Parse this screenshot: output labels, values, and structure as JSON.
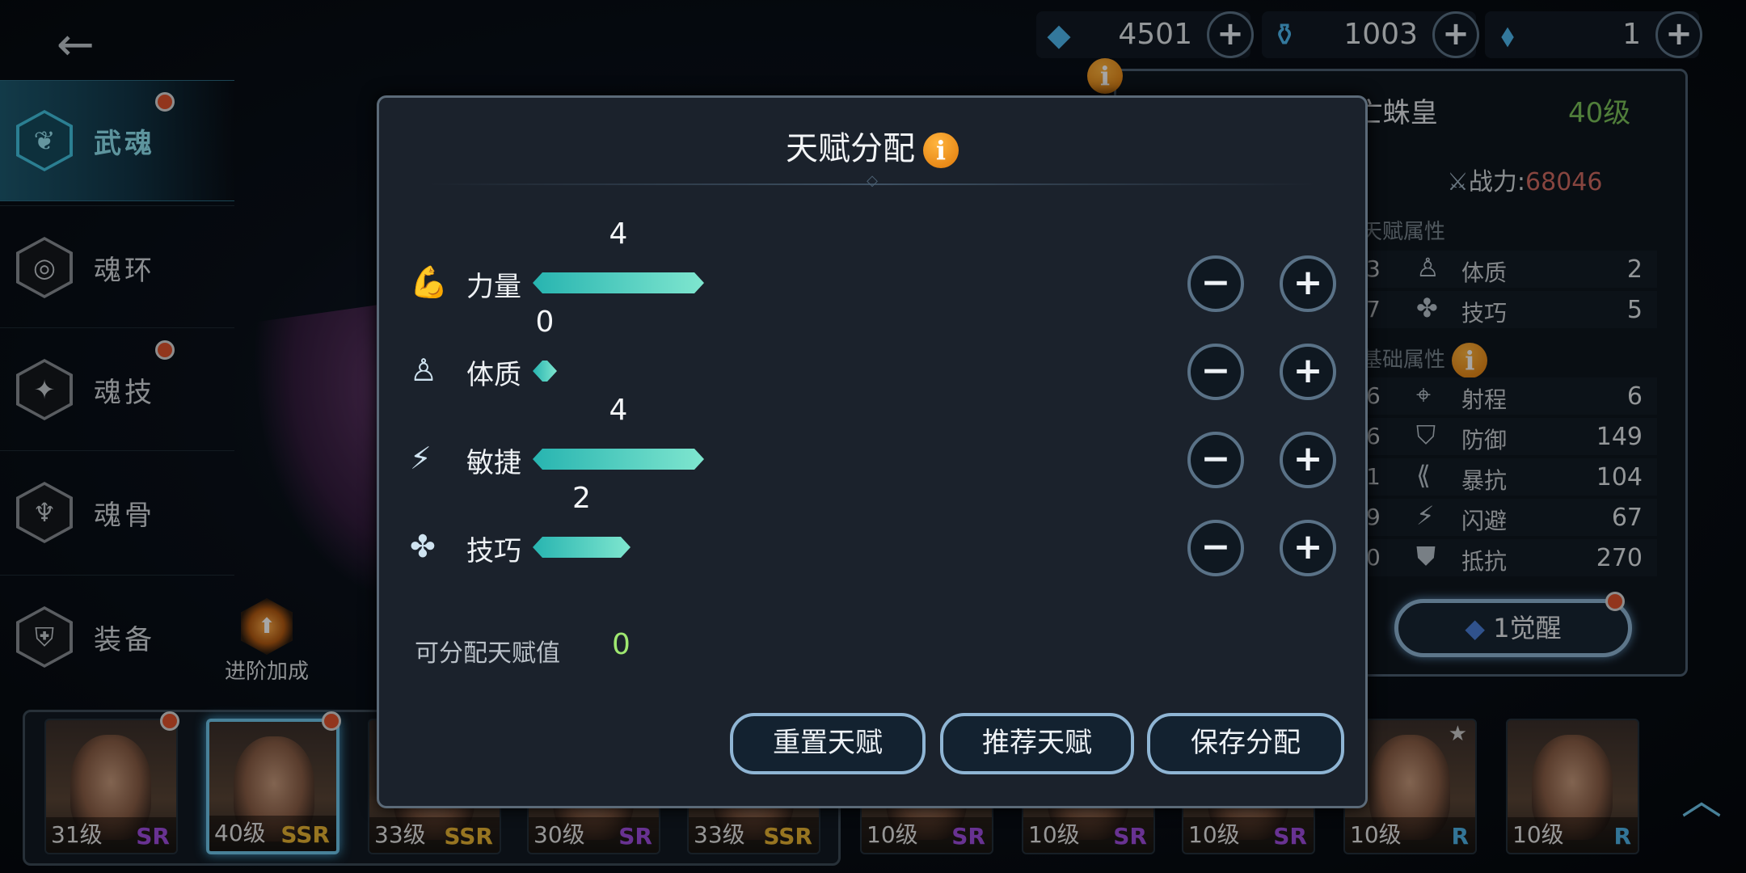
{
  "back_icon": "arrow-left",
  "sidebar": {
    "items": [
      {
        "label": "武魂",
        "icon": "sprout-hex",
        "active": true,
        "badge": true
      },
      {
        "label": "魂环",
        "icon": "ring-hex",
        "active": false,
        "badge": false
      },
      {
        "label": "魂技",
        "icon": "compass-hex",
        "active": false,
        "badge": true
      },
      {
        "label": "魂骨",
        "icon": "bone-hex",
        "active": false,
        "badge": false
      },
      {
        "label": "装备",
        "icon": "armor-hex",
        "active": false,
        "badge": false
      }
    ],
    "advance_label": "进阶加成"
  },
  "currency": [
    {
      "icon": "diamond",
      "value": "4501"
    },
    {
      "icon": "potion-vial",
      "value": "1003"
    },
    {
      "icon": "blue-crystal",
      "value": "1"
    }
  ],
  "hero_panel": {
    "name": "东·死亡蛛皇",
    "level": "40级",
    "power_label": "战力:",
    "power": "68046",
    "talent_header": "天赋属性",
    "talent_rows": [
      {
        "left": "3",
        "name": "体质",
        "value": "2",
        "icon": "body"
      },
      {
        "left": "7",
        "name": "技巧",
        "value": "5",
        "icon": "skill"
      }
    ],
    "base_header": "基础属性",
    "base_rows": [
      {
        "left": "6",
        "name": "射程",
        "value": "6",
        "icon": "crosshair"
      },
      {
        "left": "6",
        "name": "防御",
        "value": "149",
        "icon": "shield"
      },
      {
        "left": "1",
        "name": "暴抗",
        "value": "104",
        "icon": "crit-shield"
      },
      {
        "left": "9",
        "name": "闪避",
        "value": "67",
        "icon": "winged-foot"
      },
      {
        "left": "0",
        "name": "抵抗",
        "value": "270",
        "icon": "armor"
      }
    ],
    "awaken_label": "1觉醒"
  },
  "dialog": {
    "title": "天赋分配",
    "rows": [
      {
        "name": "力量",
        "value": 4,
        "icon": "flexed-arm"
      },
      {
        "name": "体质",
        "value": 0,
        "icon": "body"
      },
      {
        "name": "敏捷",
        "value": 4,
        "icon": "winged-foot"
      },
      {
        "name": "技巧",
        "value": 2,
        "icon": "skill"
      }
    ],
    "available_label": "可分配天赋值",
    "available_value": "0",
    "buttons": {
      "reset": "重置天赋",
      "recommend": "推荐天赋",
      "save": "保存分配"
    },
    "bar_color": "#4fd1c1"
  },
  "roster": [
    {
      "level": "31级",
      "rarity": "SR",
      "badge": true
    },
    {
      "level": "40级",
      "rarity": "SSR",
      "badge": true,
      "selected": true
    },
    {
      "level": "33级",
      "rarity": "SSR"
    },
    {
      "level": "30级",
      "rarity": "SR"
    },
    {
      "level": "33级",
      "rarity": "SSR"
    },
    {
      "level": "10级",
      "rarity": "SR"
    },
    {
      "level": "10级",
      "rarity": "SR"
    },
    {
      "level": "10级",
      "rarity": "SR"
    },
    {
      "level": "10级",
      "rarity": "R",
      "star": true
    },
    {
      "level": "10级",
      "rarity": "R"
    }
  ],
  "rarity_colors": {
    "SSR": "#e8b433",
    "SR": "#a04ee0",
    "R": "#4fb4e8"
  }
}
